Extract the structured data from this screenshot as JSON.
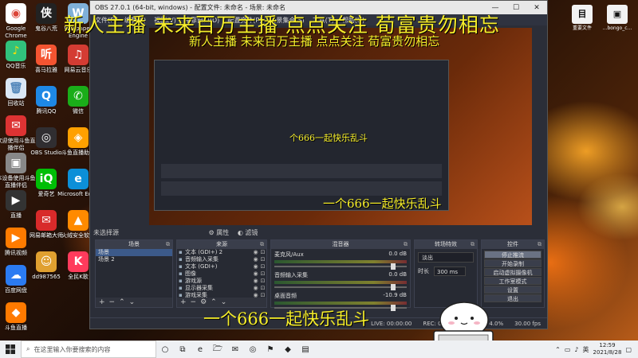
{
  "banner": {
    "top": "新人主播 未来百万主播 点点关注 荀富贵勿相忘",
    "preview": "新人主播 未来百万主播 点点关注 荀富贵勿相忘",
    "bottom": "一个666一起快乐乱斗",
    "mid": "一个666一起快乐乱斗",
    "small": "个666一起快乐乱斗"
  },
  "desktop_icons": [
    {
      "label": "Google Chrome",
      "glyph": "◉",
      "bg": "#ffffff",
      "fg": "#db4437"
    },
    {
      "label": "QQ音乐",
      "glyph": "♪",
      "bg": "#31c27c",
      "fg": "#ffdd00"
    },
    {
      "label": "回收站",
      "glyph": "🗑",
      "bg": "#dbe7f5",
      "fg": "#5588bb"
    },
    {
      "label": "欢迎使用斗鱼直播伴侣",
      "glyph": "✉",
      "bg": "#d33",
      "fg": "#fff"
    },
    {
      "label": "本设备使用斗鱼直播伴侣",
      "glyph": "▣",
      "bg": "#888",
      "fg": "#fff"
    },
    {
      "label": "直播",
      "glyph": "▶",
      "bg": "#333",
      "fg": "#fff"
    },
    {
      "label": "腾讯视频",
      "glyph": "▶",
      "bg": "#ff7b00",
      "fg": "#fff"
    },
    {
      "label": "百度网盘",
      "glyph": "☁",
      "bg": "#2b7bf2",
      "fg": "#fff"
    },
    {
      "label": "斗鱼直播",
      "glyph": "◆",
      "bg": "#ff7a00",
      "fg": "#fff"
    }
  ],
  "desktop_icons_col2": [
    {
      "label": "鬼谷八荒",
      "glyph": "侠",
      "bg": "#222",
      "fg": "#fff"
    },
    {
      "label": "喜马拉雅",
      "glyph": "听",
      "bg": "#f45431",
      "fg": "#fff"
    },
    {
      "label": "腾讯QQ",
      "glyph": "Q",
      "bg": "#1e88e5",
      "fg": "#fff"
    },
    {
      "label": "OBS Studio",
      "glyph": "◎",
      "bg": "#302e31",
      "fg": "#fff"
    },
    {
      "label": "爱奇艺",
      "glyph": "iQ",
      "bg": "#00be06",
      "fg": "#fff"
    },
    {
      "label": "网易邮箱大师",
      "glyph": "✉",
      "bg": "#d82a2a",
      "fg": "#fff"
    },
    {
      "label": "dd987565",
      "glyph": "☺",
      "bg": "#e0a030",
      "fg": "#fff"
    }
  ],
  "desktop_icons_col3": [
    {
      "label": "Wallpaper Engine",
      "glyph": "W",
      "bg": "#7fb0d8",
      "fg": "#fff"
    },
    {
      "label": "网易云音乐",
      "glyph": "♫",
      "bg": "#d43c33",
      "fg": "#fff"
    },
    {
      "label": "微信",
      "glyph": "✆",
      "bg": "#1aad19",
      "fg": "#fff"
    },
    {
      "label": "斗鱼直播助手",
      "glyph": "◈",
      "bg": "#ffa000",
      "fg": "#fff"
    },
    {
      "label": "Microsoft Edge",
      "glyph": "e",
      "bg": "#0c8fd8",
      "fg": "#fff"
    },
    {
      "label": "火绒安全软件",
      "glyph": "▲",
      "bg": "#ff8a00",
      "fg": "#fff"
    },
    {
      "label": "全民K歌",
      "glyph": "K",
      "bg": "#ff3b5c",
      "fg": "#fff"
    }
  ],
  "right_icons": [
    {
      "label": "重要文件",
      "glyph": "目"
    },
    {
      "label": "...bongo_c...",
      "glyph": "▣"
    }
  ],
  "obs": {
    "title": "OBS 27.0.1 (64-bit, windows) - 配置文件: 未命名 - 场景: 未命名",
    "menu": [
      "文件(F)",
      "编辑(E)",
      "视图(V)",
      "停靠窗口(D)",
      "配置文件(P)",
      "场景集合(S)",
      "工具(T)",
      "帮助(H)"
    ],
    "no_source": "未选择源",
    "properties": "属性",
    "filters": "滤镜",
    "docks": {
      "scenes": "场景",
      "sources": "来源",
      "mixer": "混音器",
      "transitions": "转场特效",
      "controls": "控件"
    },
    "scenes": [
      "场景",
      "场景 2"
    ],
    "sources": [
      "文本 (GDI+) 2",
      "音频输入采集",
      "文本 (GDI+)",
      "图像",
      "游戏源",
      "显示器采集",
      "游戏采集"
    ],
    "mixer": [
      {
        "name": "麦克风/Aux",
        "db": "0.0 dB"
      },
      {
        "name": "音频输入采集",
        "db": "0.0 dB"
      },
      {
        "name": "桌面音频",
        "db": "-10.9 dB"
      }
    ],
    "transition": {
      "selected": "淡出",
      "duration_label": "时长",
      "duration": "300 ms"
    },
    "controls": [
      "停止推流",
      "开始录制",
      "启动虚拟摄像机",
      "工作室模式",
      "设置",
      "退出"
    ],
    "status": {
      "live": "LIVE: 00:00:00",
      "rec": "REC: 00:00:00",
      "cpu": "CPU: 4.0%",
      "fps": "30.00 fps"
    }
  },
  "taskbar": {
    "search_placeholder": "在这里输入你要搜索的内容",
    "icons": [
      "○",
      "⧉",
      "e",
      "🗁",
      "✉",
      "◎",
      "⚑",
      "◆",
      "▤"
    ],
    "time": "12:59",
    "date": "2021/8/28",
    "lang": "英"
  }
}
